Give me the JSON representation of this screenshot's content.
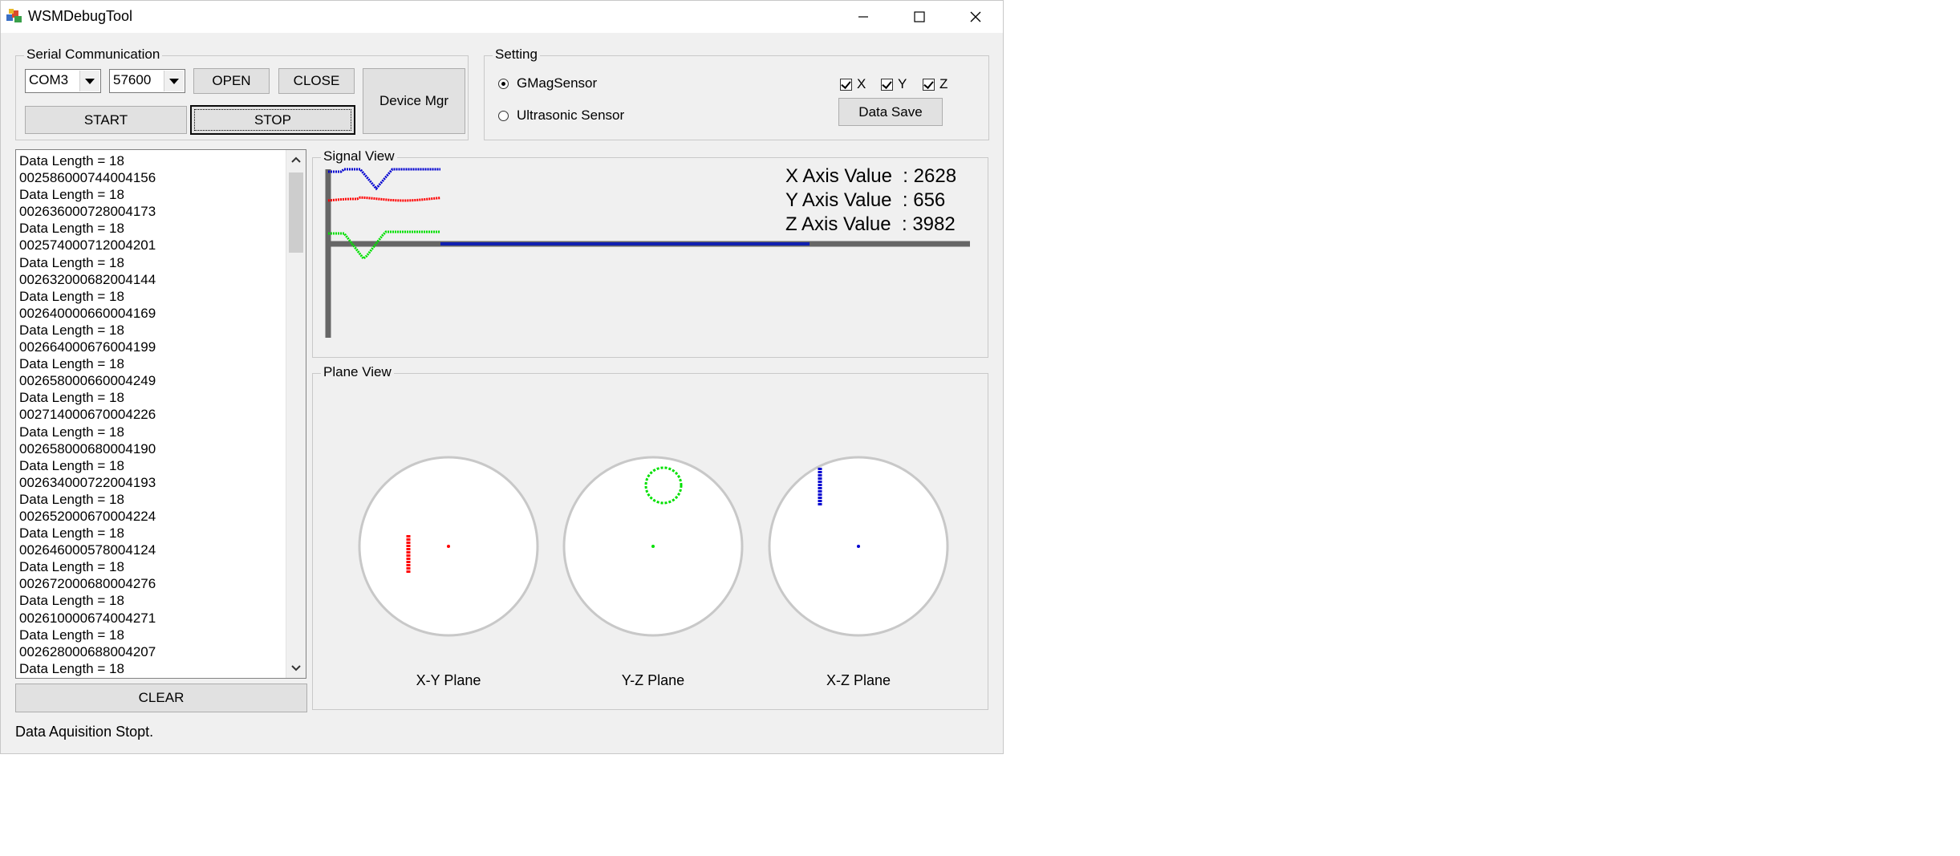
{
  "window": {
    "title": "WSMDebugTool"
  },
  "serial": {
    "group_label": "Serial Communication",
    "port_value": "COM3",
    "baud_value": "57600",
    "open_label": "OPEN",
    "close_label": "CLOSE",
    "start_label": "START",
    "stop_label": "STOP",
    "device_mgr_label": "Device Mgr"
  },
  "setting": {
    "group_label": "Setting",
    "sensors": [
      {
        "label": "GMagSensor",
        "selected": true
      },
      {
        "label": "Ultrasonic Sensor",
        "selected": false
      }
    ],
    "axes": [
      {
        "label": "X",
        "checked": true
      },
      {
        "label": "Y",
        "checked": true
      },
      {
        "label": "Z",
        "checked": true
      }
    ],
    "data_save_label": "Data Save"
  },
  "log": {
    "lines": [
      "Data Length = 18",
      "002586000744004156",
      "Data Length = 18",
      "002636000728004173",
      "Data Length = 18",
      "002574000712004201",
      "Data Length = 18",
      "002632000682004144",
      "Data Length = 18",
      "002640000660004169",
      "Data Length = 18",
      "002664000676004199",
      "Data Length = 18",
      "002658000660004249",
      "Data Length = 18",
      "002714000670004226",
      "Data Length = 18",
      "002658000680004190",
      "Data Length = 18",
      "002634000722004193",
      "Data Length = 18",
      "002652000670004224",
      "Data Length = 18",
      "002646000578004124",
      "Data Length = 18",
      "002672000680004276",
      "Data Length = 18",
      "002610000674004271",
      "Data Length = 18",
      "002628000688004207",
      "Data Length = 18"
    ],
    "clear_label": "CLEAR"
  },
  "signal_view": {
    "group_label": "Signal View",
    "x_label": "X Axis Value",
    "x_value": "2628",
    "y_label": "Y Axis Value",
    "y_value": "656",
    "z_label": "Z Axis Value",
    "z_value": "3982",
    "colors": {
      "x": "#ff0000",
      "y": "#00e000",
      "z": "#0000d0"
    }
  },
  "plane_view": {
    "group_label": "Plane View",
    "planes": [
      {
        "label": "X-Y Plane"
      },
      {
        "label": "Y-Z Plane"
      },
      {
        "label": "X-Z Plane"
      }
    ]
  },
  "status": {
    "text": "Data Aquisition Stopt."
  }
}
